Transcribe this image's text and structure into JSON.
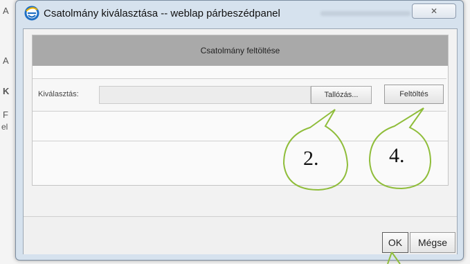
{
  "background_page": {
    "side_letters": [
      "A",
      "A",
      "K",
      "F",
      "el"
    ]
  },
  "dialog": {
    "title": "Csatolmány kiválasztása -- weblap párbeszédpanel",
    "close_label": "✕",
    "panel": {
      "header": "Csatolmány feltöltése",
      "select_label": "Kiválasztás:",
      "file_value": "",
      "browse_label": "Tallózás...",
      "upload_label": "Feltöltés"
    },
    "ok_label": "OK",
    "cancel_label": "Mégse"
  },
  "annotations": {
    "step_browse": "2.",
    "step_upload": "4.",
    "color": "#8fbd3a"
  }
}
